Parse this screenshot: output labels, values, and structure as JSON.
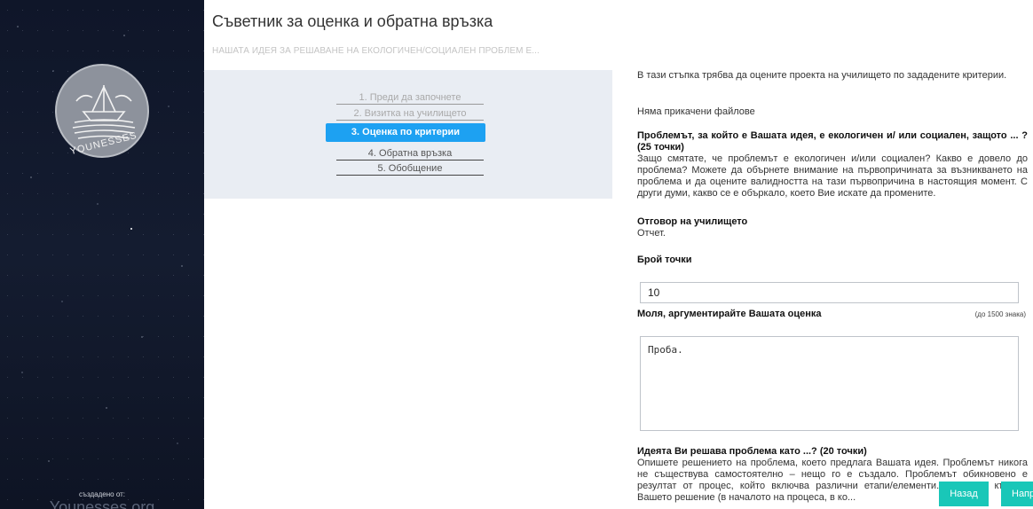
{
  "sidebar": {
    "logo_text": "YOUNESSES",
    "credit_label": "създадено от:",
    "credit_site": "Younesses.org"
  },
  "header": {
    "title": "Съветник за оценка и обратна връзка",
    "subtitle": "НАШАТА ИДЕЯ ЗА РЕШАВАНЕ НА ЕКОЛОГИЧЕН/СОЦИАЛЕН ПРОБЛЕМ Е..."
  },
  "steps": [
    {
      "label": "1. Преди да започнете",
      "state": "done"
    },
    {
      "label": "2. Визитка на училището",
      "state": "done"
    },
    {
      "label": "3. Оценка по критерии",
      "state": "active"
    },
    {
      "label": "4. Обратна връзка",
      "state": "pending"
    },
    {
      "label": "5. Обобщение",
      "state": "pending"
    }
  ],
  "content": {
    "intro": "В тази стъпка трябва да оцените проекта на училището по зададените критерии.",
    "no_files": "Няма прикачени файлове",
    "q1_title": "Проблемът, за който е Вашата идея, е екологичен и/ или социален, защото ... ? (25 точки)",
    "q1_text": "Защо смятате, че проблемът е екологичен и/или социален? Какво е довело до проблема? Можете да обърнете внимание на първопричината за възникването на проблема и да оцените валидността на тази първопричина в настоящия момент. С други думи, какво се е объркало, което Вие искате да промените.",
    "answer_title": "Отговор на училището",
    "answer_text": "Отчет.",
    "points_label": "Брой точки",
    "points_value": "10",
    "argument_label": "Моля, аргументирайте Вашата оценка",
    "limit_note": "(до 1500 знака)",
    "argument_value": "Проба.",
    "q2_title": "Идеята Ви решава проблема като ...? (20 точки)",
    "q2_text": "Опишете решението на проблема, което предлага Вашата идея. Проблемът никога не съществува самостоятелно – нещо го е създало. Проблемът обикновено е резултат от процес, който включва различни етапи/елементи. Посочете къде е Вашето решение (в началото на процеса, в ко..."
  },
  "buttons": {
    "back": "Назад",
    "next": "Напред"
  },
  "colors": {
    "active_step": "#1da1f2",
    "nav_button": "#19c7b8",
    "steps_panel": "#e9edf3"
  }
}
